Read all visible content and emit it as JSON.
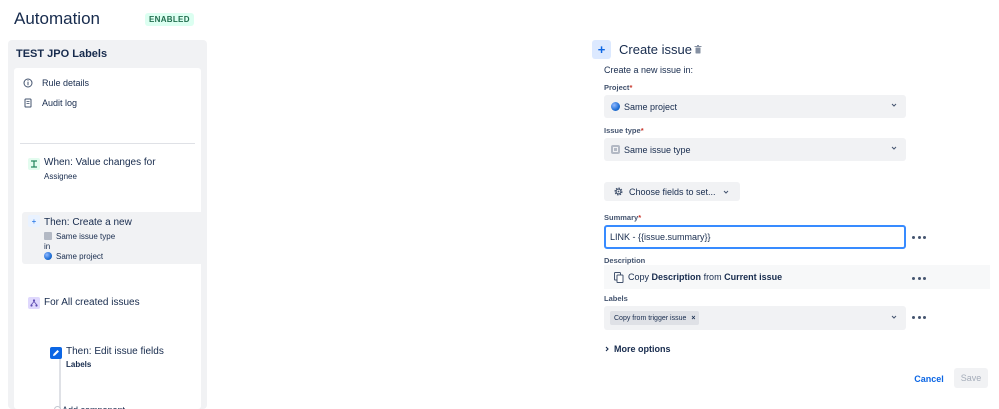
{
  "header": {
    "title": "Automation",
    "status_badge": "ENABLED"
  },
  "rule": {
    "name": "TEST JPO Labels",
    "menu": [
      {
        "label": "Rule details",
        "icon": "info-icon"
      },
      {
        "label": "Audit log",
        "icon": "document-icon"
      }
    ],
    "trigger": {
      "line1": "When: Value changes for",
      "line2": "Assignee"
    },
    "action": {
      "line1": "Then: Create a new",
      "issue_type": "Same issue type",
      "in_text": "in",
      "project": "Same project"
    },
    "branch": {
      "label": "For All created issues"
    },
    "edit_action": {
      "line1": "Then: Edit issue fields",
      "line2": "Labels"
    },
    "add_component": "Add component"
  },
  "panel": {
    "title": "Create issue",
    "subtitle": "Create a new issue in:",
    "project": {
      "label": "Project",
      "required": "*",
      "value": "Same project"
    },
    "issue_type": {
      "label": "Issue type",
      "required": "*",
      "value": "Same issue type"
    },
    "choose_fields_label": "Choose fields to set...",
    "summary": {
      "label": "Summary",
      "required": "*",
      "value": "LINK - {{issue.summary}}"
    },
    "description": {
      "label": "Description",
      "copy_text": "Copy",
      "field": "Description",
      "from_text": "from",
      "source": "Current issue"
    },
    "labels": {
      "label": "Labels",
      "tag": "Copy from trigger issue"
    },
    "more_options": "More options",
    "cancel": "Cancel",
    "save": "Save"
  },
  "colors": {
    "accent": "#0c66e4",
    "enabled_text": "#216e4e",
    "enabled_bg": "#dcfff1",
    "required": "#c9372c",
    "focus_border": "#388bff"
  }
}
